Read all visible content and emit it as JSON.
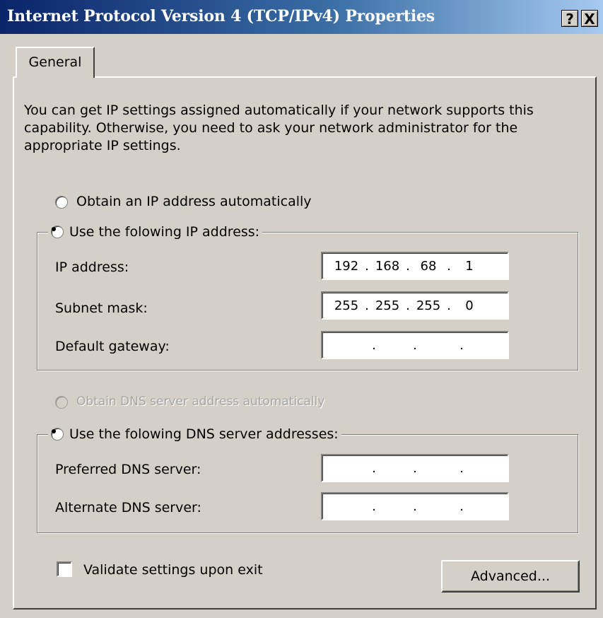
{
  "window": {
    "title": "Internet Protocol Version 4 (TCP/IPv4) Properties",
    "help_label": "?",
    "close_label": "X"
  },
  "tabs": [
    {
      "label": "General",
      "selected": true
    }
  ],
  "description": "You can get IP settings assigned automatically if your network supports this capability. Otherwise, you need to ask your network administrator for the appropriate IP settings.",
  "ip": {
    "auto_label": "Obtain an IP address automatically",
    "auto_checked": false,
    "manual_label": "Use the folowing IP address:",
    "manual_checked": true,
    "fields": [
      {
        "label": "IP address:",
        "octets": [
          "192",
          "168",
          "68",
          "1"
        ]
      },
      {
        "label": "Subnet mask:",
        "octets": [
          "255",
          "255",
          "255",
          "0"
        ]
      },
      {
        "label": "Default gateway:",
        "octets": [
          "",
          "",
          "",
          ""
        ]
      }
    ]
  },
  "dns": {
    "auto_label": "Obtain DNS server address automatically",
    "auto_enabled": false,
    "manual_label": "Use the folowing DNS server addresses:",
    "manual_checked": true,
    "fields": [
      {
        "label": "Preferred DNS server:",
        "octets": [
          "",
          "",
          "",
          ""
        ]
      },
      {
        "label": "Alternate DNS server:",
        "octets": [
          "",
          "",
          "",
          ""
        ]
      }
    ]
  },
  "validate": {
    "label": "Validate settings upon exit",
    "checked": false
  },
  "buttons": {
    "advanced_label": "Advanced..."
  },
  "colors": {
    "title_start": "#0a246a",
    "title_end": "#a6caf0",
    "face": "#d4d0c8"
  },
  "icons": {
    "help": "help-icon",
    "close": "close-icon"
  }
}
